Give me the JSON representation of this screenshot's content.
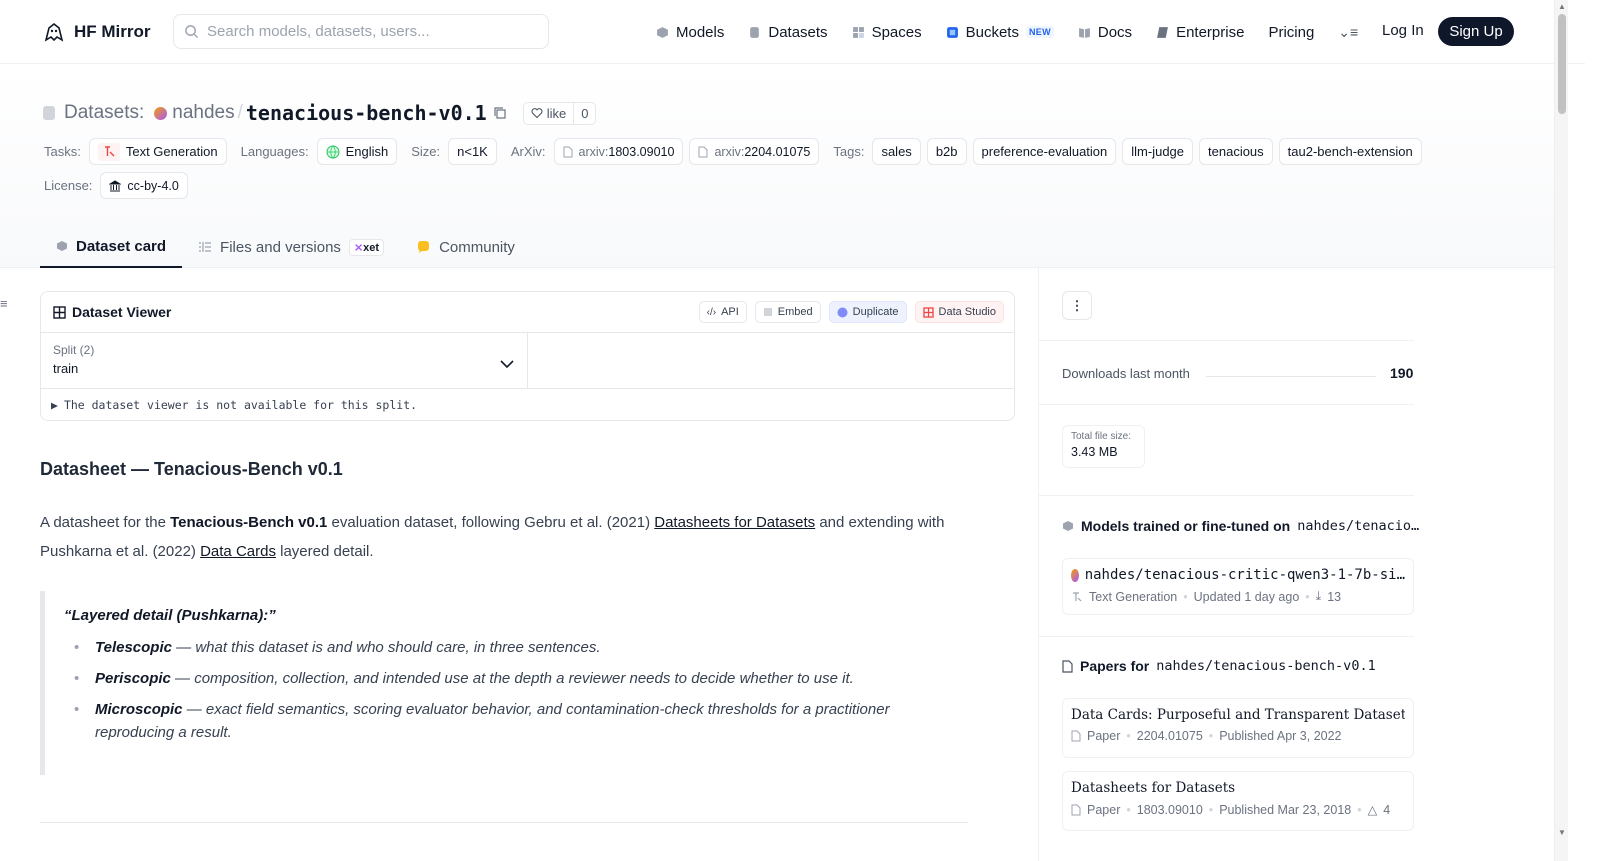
{
  "nav": {
    "brand": "HF Mirror",
    "search_placeholder": "Search models, datasets, users...",
    "links": [
      {
        "label": "Models",
        "icon": "cube-icon"
      },
      {
        "label": "Datasets",
        "icon": "database-icon"
      },
      {
        "label": "Spaces",
        "icon": "grid-icon"
      },
      {
        "label": "Buckets",
        "icon": "bucket-icon",
        "badge": "NEW"
      },
      {
        "label": "Docs",
        "icon": "book-icon"
      },
      {
        "label": "Enterprise",
        "icon": "enterprise-icon"
      },
      {
        "label": "Pricing"
      }
    ],
    "login": "Log In",
    "signup": "Sign Up"
  },
  "header": {
    "prefix": "Datasets:",
    "owner": "nahdes",
    "name": "tenacious-bench-v0.1",
    "like_label": "like",
    "like_count": "0",
    "tasks_label": "Tasks:",
    "task": "Text Generation",
    "languages_label": "Languages:",
    "language": "English",
    "size_label": "Size:",
    "size": "n<1K",
    "arxiv_label": "ArXiv:",
    "arxiv": [
      {
        "prefix": "arxiv:",
        "id": "1803.09010"
      },
      {
        "prefix": "arxiv:",
        "id": "2204.01075"
      }
    ],
    "tags_label": "Tags:",
    "tags": [
      "sales",
      "b2b",
      "preference-evaluation",
      "llm-judge",
      "tenacious",
      "tau2-bench-extension"
    ],
    "license_label": "License:",
    "license": "cc-by-4.0"
  },
  "tabs": [
    {
      "label": "Dataset card",
      "active": true
    },
    {
      "label": "Files and versions",
      "badge": "xet"
    },
    {
      "label": "Community"
    }
  ],
  "viewer": {
    "title": "Dataset Viewer",
    "buttons": [
      "API",
      "Embed",
      "Duplicate",
      "Data Studio"
    ],
    "split_label": "Split (2)",
    "split_value": "train",
    "note": "The dataset viewer is not available for this split."
  },
  "card": {
    "heading": "Datasheet — Tenacious-Bench v0.1",
    "p_a": "A datasheet for the ",
    "p_b": "Tenacious-Bench v0.1",
    "p_c": " evaluation dataset, following Gebru et al. (2021) ",
    "p_link1": "Datasheets for Datasets",
    "p_d": " and extending with Pushkarna et al. (2022) ",
    "p_link2": "Data Cards",
    "p_e": " layered detail.",
    "quote_head": "“Layered detail (Pushkarna):”",
    "bullets": [
      {
        "term": "Telescopic",
        "text": " — what this dataset is and who should care, in three sentences."
      },
      {
        "term": "Periscopic",
        "text": " — composition, collection, and intended use at the depth a reviewer needs to decide whether to use it."
      },
      {
        "term": "Microscopic",
        "text": " — exact field semantics, scoring evaluator behavior, and contamination-check thresholds for a practitioner reproducing a result."
      }
    ]
  },
  "sidebar": {
    "downloads_label": "Downloads last month",
    "downloads_value": "190",
    "filesize_label": "Total file size:",
    "filesize_value": "3.43 MB",
    "models_title": "Models trained or fine-tuned on",
    "models_repo": "nahdes/tenacio…",
    "model_name": "nahdes/tenacious-critic-qwen3-1-7b-si…",
    "model_task": "Text Generation",
    "model_updated": "Updated 1 day ago",
    "model_downloads": "13",
    "papers_title": "Papers for",
    "papers_repo": "nahdes/tenacious-bench-v0.1",
    "papers": [
      {
        "title": "Data Cards: Purposeful and Transparent Dataset D…",
        "kind": "Paper",
        "id": "2204.01075",
        "published": "Published Apr 3, 2022"
      },
      {
        "title": "Datasheets for Datasets",
        "kind": "Paper",
        "id": "1803.09010",
        "published": "Published Mar 23, 2018",
        "upvotes": "4"
      }
    ]
  }
}
